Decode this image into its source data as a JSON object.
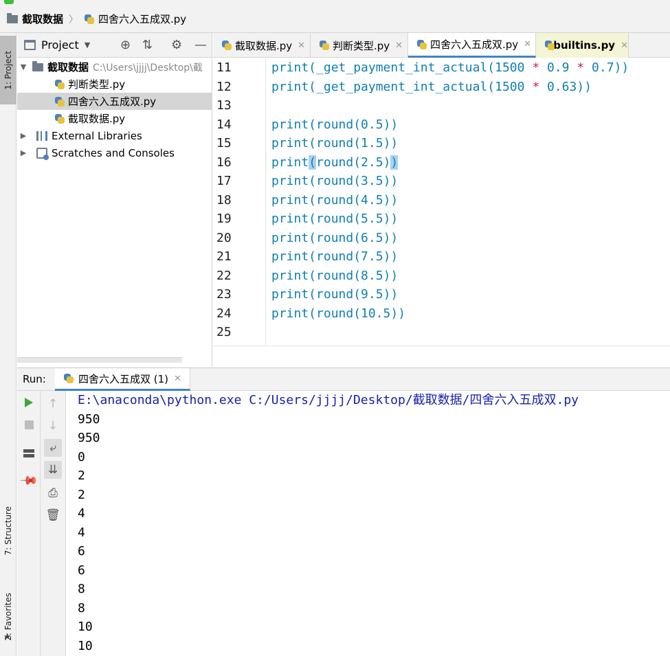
{
  "navbar": {
    "project_name": "截取数据",
    "file_name": "四舍六入五成双.py"
  },
  "side_tabs": {
    "project": "1: Project",
    "structure": "7: Structure",
    "favorites": "2: Favorites"
  },
  "project_panel": {
    "title": "Project",
    "root": {
      "name": "截取数据",
      "path": "C:\\Users\\jjjj\\Desktop\\截"
    },
    "files": [
      "判断类型.py",
      "四舍六入五成双.py",
      "截取数据.py"
    ],
    "external_libraries": "External Libraries",
    "scratches": "Scratches and Consoles",
    "selected_file": "四舍六入五成双.py"
  },
  "editor": {
    "tabs": [
      {
        "label": "截取数据.py",
        "active": false
      },
      {
        "label": "判断类型.py",
        "active": false
      },
      {
        "label": "四舍六入五成双.py",
        "active": true
      },
      {
        "label": "builtins.py",
        "active": false
      }
    ],
    "caret_line": 16,
    "lines": [
      {
        "num": "11",
        "code": "print(_get_payment_int_actual(1500 * 0.9 * 0.7))"
      },
      {
        "num": "12",
        "code": "print(_get_payment_int_actual(1500 * 0.63))"
      },
      {
        "num": "13",
        "code": ""
      },
      {
        "num": "14",
        "code": "print(round(0.5))"
      },
      {
        "num": "15",
        "code": "print(round(1.5))"
      },
      {
        "num": "16",
        "code": "print(round(2.5))"
      },
      {
        "num": "17",
        "code": "print(round(3.5))"
      },
      {
        "num": "18",
        "code": "print(round(4.5))"
      },
      {
        "num": "19",
        "code": "print(round(5.5))"
      },
      {
        "num": "20",
        "code": "print(round(6.5))"
      },
      {
        "num": "21",
        "code": "print(round(7.5))"
      },
      {
        "num": "22",
        "code": "print(round(8.5))"
      },
      {
        "num": "23",
        "code": "print(round(9.5))"
      },
      {
        "num": "24",
        "code": "print(round(10.5))"
      },
      {
        "num": "25",
        "code": ""
      }
    ]
  },
  "run": {
    "label": "Run:",
    "tab": "四舍六入五成双 (1)",
    "command": "E:\\anaconda\\python.exe C:/Users/jjjj/Desktop/截取数据/四舍六入五成双.py",
    "output": [
      "950",
      "950",
      "0",
      "2",
      "2",
      "4",
      "4",
      "6",
      "6",
      "8",
      "8",
      "10",
      "10"
    ]
  }
}
